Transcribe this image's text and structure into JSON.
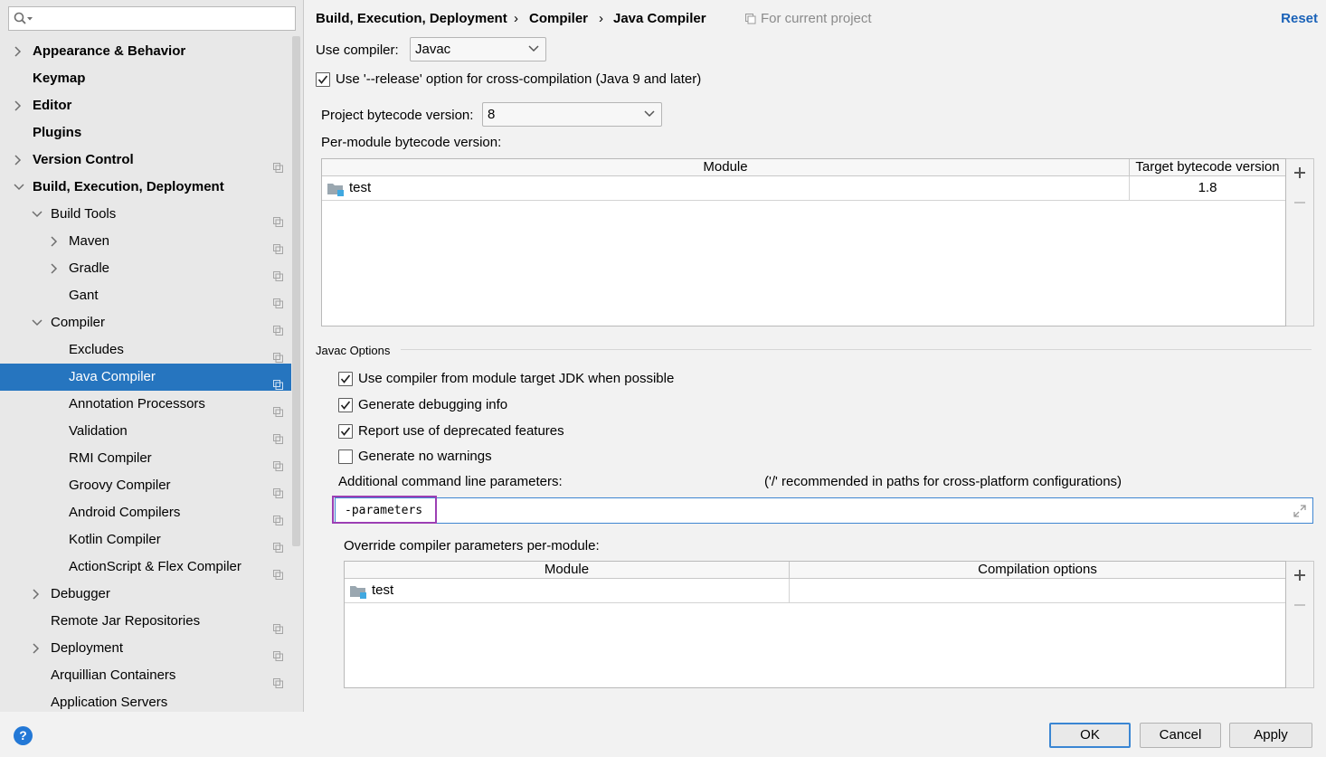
{
  "sidebar": {
    "search": {
      "value": "",
      "placeholder": ""
    },
    "items": [
      {
        "label": "Appearance & Behavior",
        "bold": true,
        "arrow": "right",
        "level": 0
      },
      {
        "label": "Keymap",
        "bold": true,
        "arrow": "none",
        "level": 0
      },
      {
        "label": "Editor",
        "bold": true,
        "arrow": "right",
        "level": 0
      },
      {
        "label": "Plugins",
        "bold": true,
        "arrow": "none",
        "level": 0
      },
      {
        "label": "Version Control",
        "bold": true,
        "arrow": "right",
        "level": 0,
        "project_icon": true
      },
      {
        "label": "Build, Execution, Deployment",
        "bold": true,
        "arrow": "down",
        "level": 0
      },
      {
        "label": "Build Tools",
        "bold": false,
        "arrow": "down",
        "level": 1,
        "project_icon": true
      },
      {
        "label": "Maven",
        "bold": false,
        "arrow": "right",
        "level": 2,
        "project_icon": true
      },
      {
        "label": "Gradle",
        "bold": false,
        "arrow": "right",
        "level": 2,
        "project_icon": true
      },
      {
        "label": "Gant",
        "bold": false,
        "arrow": "none",
        "level": 2,
        "project_icon": true
      },
      {
        "label": "Compiler",
        "bold": false,
        "arrow": "down",
        "level": 1,
        "project_icon": true
      },
      {
        "label": "Excludes",
        "bold": false,
        "arrow": "none",
        "level": 2,
        "project_icon": true
      },
      {
        "label": "Java Compiler",
        "bold": false,
        "arrow": "none",
        "level": 2,
        "project_icon": true,
        "selected": true
      },
      {
        "label": "Annotation Processors",
        "bold": false,
        "arrow": "none",
        "level": 2,
        "project_icon": true
      },
      {
        "label": "Validation",
        "bold": false,
        "arrow": "none",
        "level": 2,
        "project_icon": true
      },
      {
        "label": "RMI Compiler",
        "bold": false,
        "arrow": "none",
        "level": 2,
        "project_icon": true
      },
      {
        "label": "Groovy Compiler",
        "bold": false,
        "arrow": "none",
        "level": 2,
        "project_icon": true
      },
      {
        "label": "Android Compilers",
        "bold": false,
        "arrow": "none",
        "level": 2,
        "project_icon": true
      },
      {
        "label": "Kotlin Compiler",
        "bold": false,
        "arrow": "none",
        "level": 2,
        "project_icon": true
      },
      {
        "label": "ActionScript & Flex Compiler",
        "bold": false,
        "arrow": "none",
        "level": 2,
        "project_icon": true
      },
      {
        "label": "Debugger",
        "bold": false,
        "arrow": "right",
        "level": 1
      },
      {
        "label": "Remote Jar Repositories",
        "bold": false,
        "arrow": "none",
        "level": 1,
        "project_icon": true
      },
      {
        "label": "Deployment",
        "bold": false,
        "arrow": "right",
        "level": 1,
        "project_icon": true
      },
      {
        "label": "Arquillian Containers",
        "bold": false,
        "arrow": "none",
        "level": 1,
        "project_icon": true
      },
      {
        "label": "Application Servers",
        "bold": false,
        "arrow": "none",
        "level": 1
      }
    ]
  },
  "header": {
    "breadcrumb": [
      "Build, Execution, Deployment",
      "Compiler",
      "Java Compiler"
    ],
    "separator": "›",
    "for_current_project": "For current project",
    "reset": "Reset"
  },
  "compiler": {
    "use_compiler_label": "Use compiler:",
    "use_compiler_value": "Javac",
    "release_option_label": "Use '--release' option for cross-compilation (Java 9 and later)",
    "release_option_checked": true,
    "project_bytecode_label": "Project bytecode version:",
    "project_bytecode_value": "8",
    "per_module_label": "Per-module bytecode version:",
    "module_table": {
      "columns": [
        "Module",
        "Target bytecode version"
      ],
      "rows": [
        {
          "module": "test",
          "target": "1.8"
        }
      ]
    }
  },
  "javac": {
    "section_title": "Javac Options",
    "options": [
      {
        "label": "Use compiler from module target JDK when possible",
        "checked": true
      },
      {
        "label": "Generate debugging info",
        "checked": true
      },
      {
        "label": "Report use of deprecated features",
        "checked": true
      },
      {
        "label": "Generate no warnings",
        "checked": false
      }
    ],
    "additional_params_label": "Additional command line parameters:",
    "additional_params_hint": "('/' recommended in paths for cross-platform configurations)",
    "additional_params_value": "-parameters",
    "override_label": "Override compiler parameters per-module:",
    "override_table": {
      "columns": [
        "Module",
        "Compilation options"
      ],
      "rows": [
        {
          "module": "test",
          "options": ""
        }
      ]
    }
  },
  "buttons": {
    "help": "?",
    "ok": "OK",
    "cancel": "Cancel",
    "apply": "Apply"
  },
  "colors": {
    "selection": "#2675bf",
    "link": "#1a62b8",
    "highlight_box": "#9c3fb4",
    "focus": "#3f86d2"
  }
}
